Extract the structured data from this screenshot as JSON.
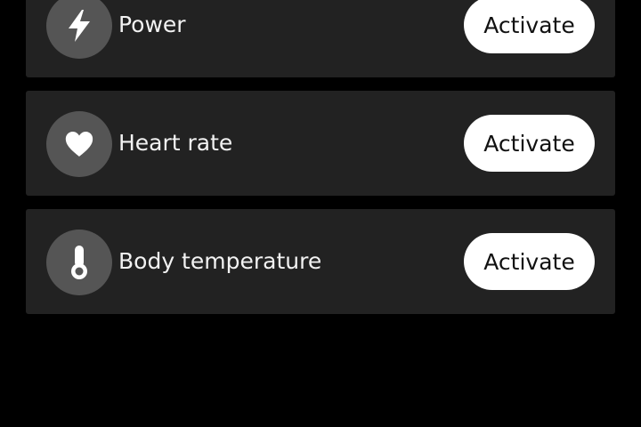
{
  "colors": {
    "background": "#000000",
    "row_background": "#222222",
    "icon_background": "#555555",
    "button_background": "#ffffff",
    "label_text": "#f2f2f2",
    "button_text": "#111111"
  },
  "sensors": [
    {
      "label": "Power",
      "icon": "lightning-icon",
      "button_label": "Activate"
    },
    {
      "label": "Heart rate",
      "icon": "heart-icon",
      "button_label": "Activate"
    },
    {
      "label": "Body temperature",
      "icon": "thermometer-icon",
      "button_label": "Activate"
    }
  ]
}
